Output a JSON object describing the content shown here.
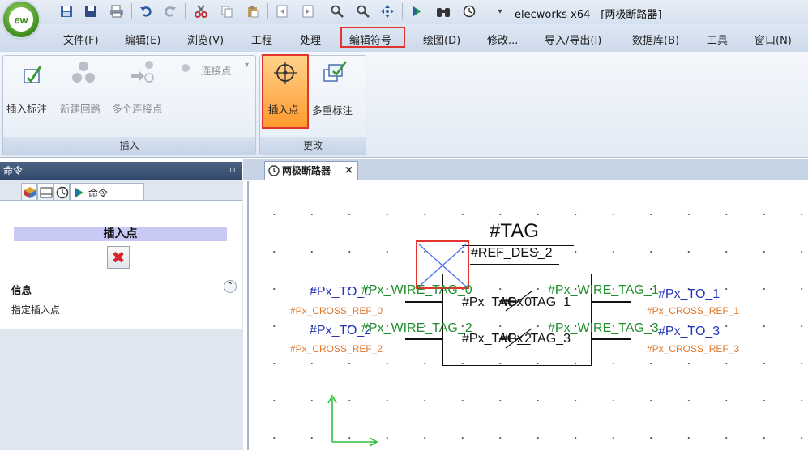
{
  "window": {
    "title": "elecworks x64 - [两极断路器]",
    "app_logo": "ew"
  },
  "quick_access": [
    "save-icon",
    "disk-icon",
    "print-icon",
    "undo-icon",
    "redo-icon",
    "cut-icon",
    "copy-icon",
    "paste-icon",
    "page-prev-icon",
    "page-next-icon",
    "zoom-icon",
    "zoom-window-icon",
    "pan-icon",
    "play-icon",
    "binoculars-icon",
    "clock-icon",
    "dropdown-icon"
  ],
  "menu": [
    "文件(F)",
    "编辑(E)",
    "浏览(V)",
    "工程",
    "处理",
    "编辑符号",
    "绘图(D)",
    "修改...",
    "导入/导出(I)",
    "数据库(B)",
    "工具",
    "窗口(N)"
  ],
  "menu_active": "编辑符号",
  "ribbon": {
    "groups": [
      {
        "label": "插入",
        "buttons": [
          {
            "label": "插入标注",
            "icon": "insert-tag-icon"
          },
          {
            "label": "新建回路",
            "icon": "new-circuit-icon"
          },
          {
            "label": "多个连接点",
            "icon": "multi-connection-icon"
          },
          {
            "label": "连接点",
            "icon": "connection-point-icon"
          }
        ]
      },
      {
        "label": "更改",
        "buttons": [
          {
            "label": "插入点",
            "icon": "insert-point-icon"
          },
          {
            "label": "多重标注",
            "icon": "multi-tag-icon"
          }
        ]
      }
    ]
  },
  "left_panel": {
    "title": "命令",
    "pin": "ᵖ",
    "tab_label": "命令",
    "command_title": "插入点",
    "info_heading": "信息",
    "info_text": "指定插入点"
  },
  "document": {
    "tab_label": "两极断路器",
    "close": "×"
  },
  "symbol": {
    "tag": "#TAG",
    "ref_des": "#REF_DES_2",
    "left_pins": [
      "#Px_TO_0",
      "#Px_TO_2"
    ],
    "left_wires": [
      "#Px_WIRE_TAG_0",
      "#Px_WIRE_TAG_2"
    ],
    "left_cross": [
      "#Px_CROSS_REF_0",
      "#Px_CROSS_REF_2"
    ],
    "right_pins": [
      "#Px_TO_1",
      "#Px_TO_3"
    ],
    "right_wires": [
      "#Px_WIRE_TAG_1",
      "#Px_WIRE_TAG_3"
    ],
    "right_cross": [
      "#Px_CROSS_REF_1",
      "#Px_CROSS_REF_3"
    ],
    "inner_left": [
      "#Px_TAG_0",
      "#Px_TAG_2"
    ],
    "inner_right": [
      "#Px_TAG_1",
      "#Px_TAG_3"
    ]
  },
  "colors": {
    "highlight": "#e0342c",
    "pin_text": "#2535b8",
    "wire_text": "#1f8f2c",
    "cross_ref_text": "#e0762a",
    "active_button": "#ff9a2e"
  }
}
